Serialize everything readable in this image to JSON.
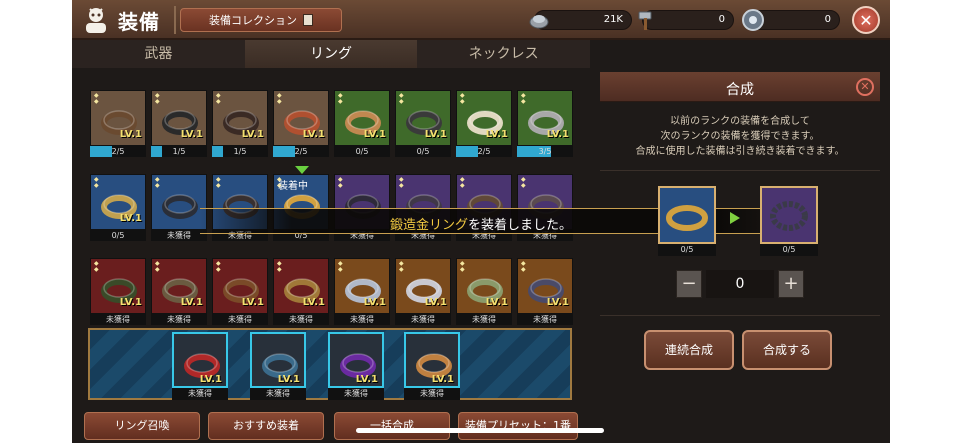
{
  "header": {
    "title": "装備",
    "collection_label": "装備コレクション",
    "resources": [
      {
        "icon": "silver-ingot-icon",
        "value": "21K"
      },
      {
        "icon": "hammer-icon",
        "value": "0"
      },
      {
        "icon": "gear-stone-icon",
        "value": "0"
      }
    ]
  },
  "tabs": [
    {
      "label": "武器",
      "active": false
    },
    {
      "label": "リング",
      "active": true
    },
    {
      "label": "ネックレス",
      "active": false
    }
  ],
  "inventory": {
    "row1": [
      {
        "bg": "#6b5440",
        "ring": "#6a4a30",
        "lv": "LV.1",
        "count": "2/5",
        "progress": 0.4
      },
      {
        "bg": "#6b5440",
        "ring": "#2a2a2a",
        "lv": "LV.1",
        "count": "1/5",
        "progress": 0.2
      },
      {
        "bg": "#6b5440",
        "ring": "#3a2a24",
        "lv": "LV.1",
        "count": "1/5",
        "progress": 0.2
      },
      {
        "bg": "#6b5440",
        "ring": "#b05030",
        "lv": "LV.1",
        "count": "2/5",
        "progress": 0.4
      },
      {
        "bg": "#3f6a2a",
        "ring": "#c08850",
        "lv": "LV.1",
        "count": "0/5",
        "progress": 0
      },
      {
        "bg": "#3f6a2a",
        "ring": "#3a3a3a",
        "lv": "LV.1",
        "count": "0/5",
        "progress": 0
      },
      {
        "bg": "#3f6a2a",
        "ring": "#e0d8c0",
        "lv": "LV.1",
        "count": "2/5",
        "progress": 0.4
      },
      {
        "bg": "#3f6a2a",
        "ring": "#a8a8a8",
        "lv": "LV.1",
        "count": "3/5",
        "progress": 0.6
      }
    ],
    "row2": [
      {
        "bg": "#284e80",
        "ring": "#c0a050",
        "lv": "LV.1",
        "count": "0/5",
        "progress": 0
      },
      {
        "bg": "#284e80",
        "ring": "#2a2e38",
        "lv": "",
        "count": "未獲得",
        "progress": 0
      },
      {
        "bg": "#284e80",
        "ring": "#383030",
        "lv": "",
        "count": "未獲得",
        "progress": 0
      },
      {
        "bg": "#284e80",
        "ring": "#d0a040",
        "lv": "",
        "count": "0/5",
        "progress": 0,
        "equipped": "装着中"
      },
      {
        "bg": "#4a3470",
        "ring": "#2e2a3a",
        "lv": "",
        "count": "未獲得",
        "progress": 0
      },
      {
        "bg": "#4a3470",
        "ring": "#403848",
        "lv": "",
        "count": "未獲得",
        "progress": 0
      },
      {
        "bg": "#4a3470",
        "ring": "#604838",
        "lv": "",
        "count": "未獲得",
        "progress": 0
      },
      {
        "bg": "#4a3470",
        "ring": "#5a4a50",
        "lv": "",
        "count": "未獲得",
        "progress": 0
      }
    ],
    "row3": [
      {
        "bg": "#6a1e1e",
        "ring": "#3a4a28",
        "lv": "LV.1",
        "count": "未獲得",
        "progress": 0
      },
      {
        "bg": "#6a1e1e",
        "ring": "#6a5a40",
        "lv": "LV.1",
        "count": "未獲得",
        "progress": 0
      },
      {
        "bg": "#6a1e1e",
        "ring": "#7a4a28",
        "lv": "LV.1",
        "count": "未獲得",
        "progress": 0
      },
      {
        "bg": "#6a1e1e",
        "ring": "#a07838",
        "lv": "LV.1",
        "count": "未獲得",
        "progress": 0
      },
      {
        "bg": "#7a4a1c",
        "ring": "#b0b8c8",
        "lv": "LV.1",
        "count": "未獲得",
        "progress": 0
      },
      {
        "bg": "#7a4a1c",
        "ring": "#c8c8d0",
        "lv": "LV.1",
        "count": "未獲得",
        "progress": 0
      },
      {
        "bg": "#7a4a1c",
        "ring": "#8a9a6a",
        "lv": "LV.1",
        "count": "未獲得",
        "progress": 0
      },
      {
        "bg": "#7a4a1c",
        "ring": "#4a4a68",
        "lv": "LV.1",
        "count": "未獲得",
        "progress": 0
      }
    ]
  },
  "toast": {
    "highlight": "鍛造金リング",
    "rest": "を装着しました。"
  },
  "slots": [
    {
      "ring": "#b02828",
      "lv": "LV.1",
      "label": "未獲得"
    },
    {
      "ring": "#3a6a8a",
      "lv": "LV.1",
      "label": "未獲得"
    },
    {
      "ring": "#6a2aa0",
      "lv": "LV.1",
      "label": "未獲得"
    },
    {
      "ring": "#c08040",
      "lv": "LV.1",
      "label": "未獲得"
    }
  ],
  "bottom_buttons": [
    "リング召喚",
    "おすすめ装着",
    "一括合成",
    "装備プリセット：1番"
  ],
  "fusion": {
    "title": "合成",
    "desc_line1": "以前のランクの装備を合成して",
    "desc_line2": "次のランクの装備を獲得できます。",
    "desc_line3": "合成に使用した装備は引き続き装着できます。",
    "src_count": "0/5",
    "dst_count": "0/5",
    "quantity": "0",
    "btn_continuous": "連続合成",
    "btn_fuse": "合成する"
  },
  "colors": {
    "accent": "#8b4a34",
    "progress": "#30a8d0",
    "equipped_arrow": "#6ad040"
  }
}
